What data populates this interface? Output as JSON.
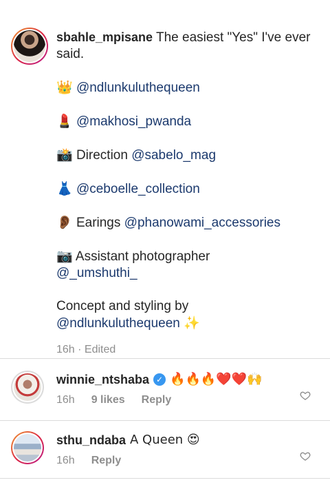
{
  "caption": {
    "username": "sbahle_mpisane",
    "first_text": "The easiest \"Yes\" I've ever said.",
    "lines": [
      {
        "emoji": "👑",
        "prefix": "",
        "mention": "@ndlunkuluthequeen"
      },
      {
        "emoji": "💄",
        "prefix": "",
        "mention": "@makhosi_pwanda"
      },
      {
        "emoji": "📸",
        "prefix": "Direction ",
        "mention": "@sabelo_mag"
      },
      {
        "emoji": "👗",
        "prefix": "",
        "mention": "@ceboelle_collection"
      },
      {
        "emoji": "👂🏾",
        "prefix": "Earings ",
        "mention": "@phanowami_accessories"
      },
      {
        "emoji": "📷",
        "prefix": "Assistant photographer",
        "mention": "@_umshuthi_"
      },
      {
        "emoji": "",
        "prefix": "Concept and styling by",
        "mention": "@ndlunkuluthequeen",
        "suffix_emoji": "✨"
      }
    ],
    "meta": "16h · Edited"
  },
  "comments": [
    {
      "username": "winnie_ntshaba",
      "verified": true,
      "text": "🔥🔥🔥❤️❤️🙌",
      "time": "16h",
      "likes": "9 likes",
      "reply": "Reply"
    },
    {
      "username": "sthu_ndaba",
      "verified": false,
      "text": "A Queen 😍",
      "time": "16h",
      "likes": "",
      "reply": "Reply"
    }
  ],
  "icons": {
    "heart": "heart-outline-icon",
    "verified": "verified-badge-icon"
  },
  "colors": {
    "mention": "#1c3a6e",
    "meta": "#8e8e8e",
    "verified": "#3897f0"
  }
}
